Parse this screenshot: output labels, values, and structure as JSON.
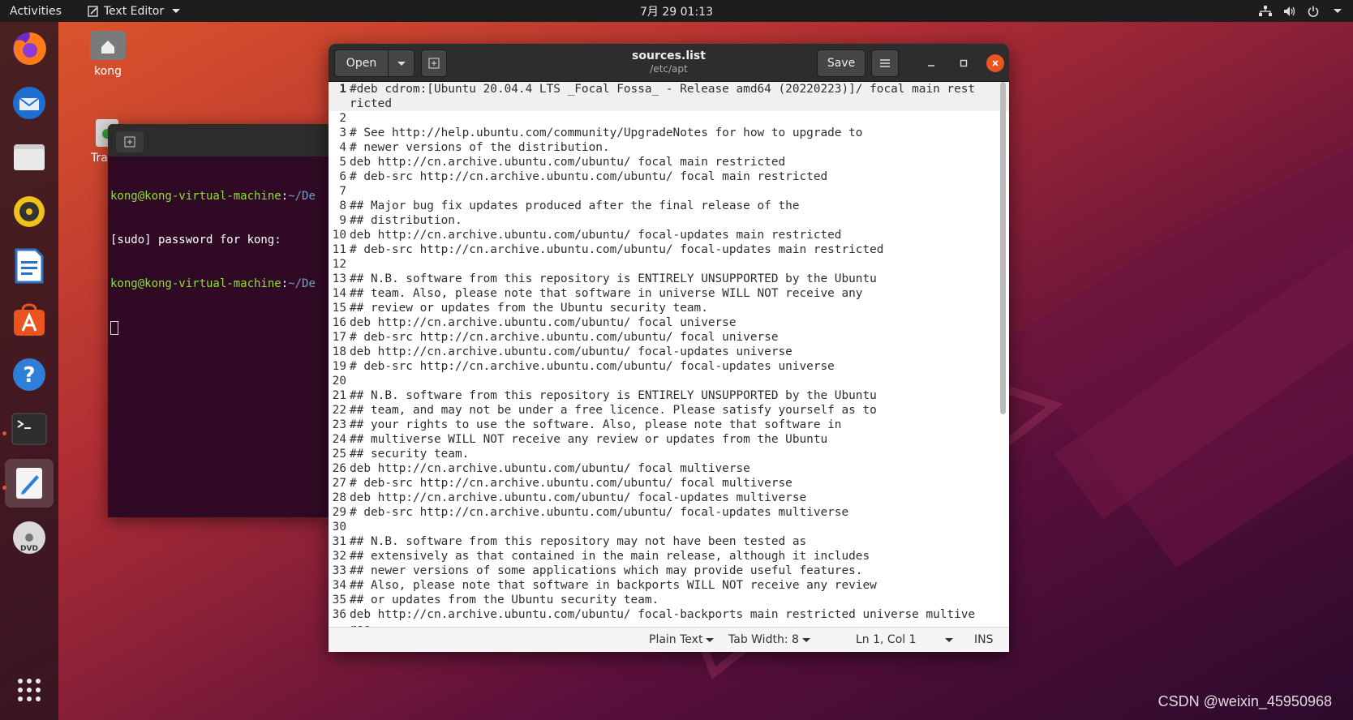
{
  "topbar": {
    "activities": "Activities",
    "app_menu": "Text Editor",
    "clock": "7月 29  01:13"
  },
  "desktop": {
    "home_label": "kong",
    "trash_label": "Tra"
  },
  "dock": {
    "items": [
      "firefox-icon",
      "thunderbird-icon",
      "files-icon",
      "rhythmbox-icon",
      "libreoffice-writer-icon",
      "software-center-icon",
      "help-icon",
      "terminal-icon",
      "text-editor-icon",
      "dvd-icon"
    ],
    "show_apps": "apps-grid-icon"
  },
  "terminal": {
    "lines": [
      {
        "user": "kong@kong-virtual-machine",
        "sep": ":",
        "path": "~/De"
      },
      {
        "text": "[sudo] password for kong:"
      },
      {
        "user": "kong@kong-virtual-machine",
        "sep": ":",
        "path": "~/De"
      }
    ]
  },
  "editor": {
    "open_label": "Open",
    "save_label": "Save",
    "title": "sources.list",
    "subtitle": "/etc/apt",
    "lines": [
      "#deb cdrom:[Ubuntu 20.04.4 LTS _Focal Fossa_ - Release amd64 (20220223)]/ focal main restricted",
      "",
      "# See http://help.ubuntu.com/community/UpgradeNotes for how to upgrade to",
      "# newer versions of the distribution.",
      "deb http://cn.archive.ubuntu.com/ubuntu/ focal main restricted",
      "# deb-src http://cn.archive.ubuntu.com/ubuntu/ focal main restricted",
      "",
      "## Major bug fix updates produced after the final release of the",
      "## distribution.",
      "deb http://cn.archive.ubuntu.com/ubuntu/ focal-updates main restricted",
      "# deb-src http://cn.archive.ubuntu.com/ubuntu/ focal-updates main restricted",
      "",
      "## N.B. software from this repository is ENTIRELY UNSUPPORTED by the Ubuntu",
      "## team. Also, please note that software in universe WILL NOT receive any",
      "## review or updates from the Ubuntu security team.",
      "deb http://cn.archive.ubuntu.com/ubuntu/ focal universe",
      "# deb-src http://cn.archive.ubuntu.com/ubuntu/ focal universe",
      "deb http://cn.archive.ubuntu.com/ubuntu/ focal-updates universe",
      "# deb-src http://cn.archive.ubuntu.com/ubuntu/ focal-updates universe",
      "",
      "## N.B. software from this repository is ENTIRELY UNSUPPORTED by the Ubuntu",
      "## team, and may not be under a free licence. Please satisfy yourself as to",
      "## your rights to use the software. Also, please note that software in",
      "## multiverse WILL NOT receive any review or updates from the Ubuntu",
      "## security team.",
      "deb http://cn.archive.ubuntu.com/ubuntu/ focal multiverse",
      "# deb-src http://cn.archive.ubuntu.com/ubuntu/ focal multiverse",
      "deb http://cn.archive.ubuntu.com/ubuntu/ focal-updates multiverse",
      "# deb-src http://cn.archive.ubuntu.com/ubuntu/ focal-updates multiverse",
      "",
      "## N.B. software from this repository may not have been tested as",
      "## extensively as that contained in the main release, although it includes",
      "## newer versions of some applications which may provide useful features.",
      "## Also, please note that software in backports WILL NOT receive any review",
      "## or updates from the Ubuntu security team.",
      "deb http://cn.archive.ubuntu.com/ubuntu/ focal-backports main restricted universe multiverse"
    ],
    "status": {
      "language": "Plain Text",
      "tab_width": "Tab Width: 8",
      "position": "Ln 1, Col 1",
      "mode": "INS"
    }
  },
  "watermark": "CSDN @weixin_45950968",
  "colors": {
    "accent": "#e95420",
    "terminal_bg": "#300a24"
  }
}
